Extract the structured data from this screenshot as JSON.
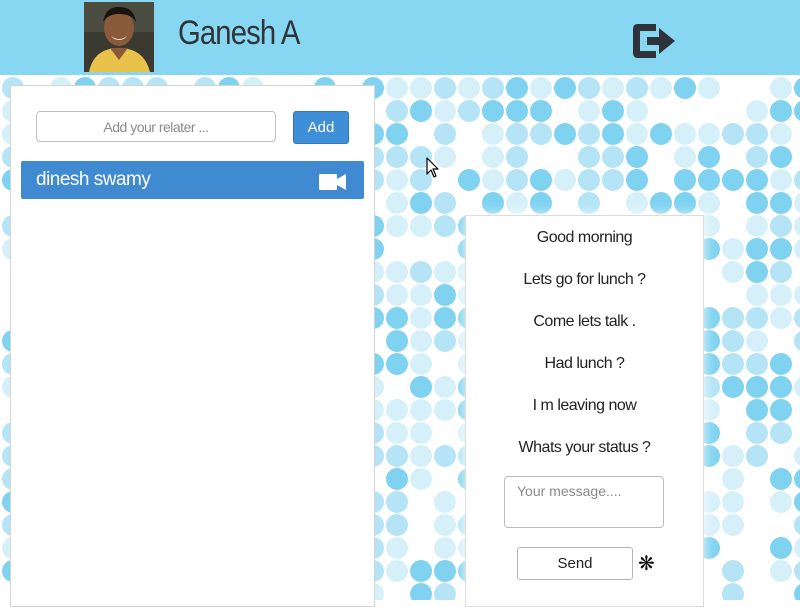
{
  "header": {
    "user_name": "Ganesh A",
    "icons": {
      "avatar": "user-photo",
      "logout": "logout-icon"
    }
  },
  "relaters": {
    "input_placeholder": "Add your relater ...",
    "input_value": "",
    "add_label": "Add",
    "contacts": [
      {
        "name": "dinesh swamy",
        "icon": "video-camera-icon"
      }
    ]
  },
  "chat": {
    "quick_messages": [
      "Good morning",
      "Lets go for lunch ?",
      "Come lets talk .",
      "Had lunch ?",
      "I m leaving now",
      "Whats your status ?"
    ],
    "message_placeholder": "Your message....",
    "message_value": "",
    "send_label": "Send",
    "asterisk": "❋"
  },
  "colors": {
    "header_bg": "#87d6f2",
    "accent_blue": "#3f8ad0",
    "dot_dark": "#7fd3f0",
    "dot_mid": "#b4e4f6",
    "dot_light": "#d6f0fa"
  }
}
